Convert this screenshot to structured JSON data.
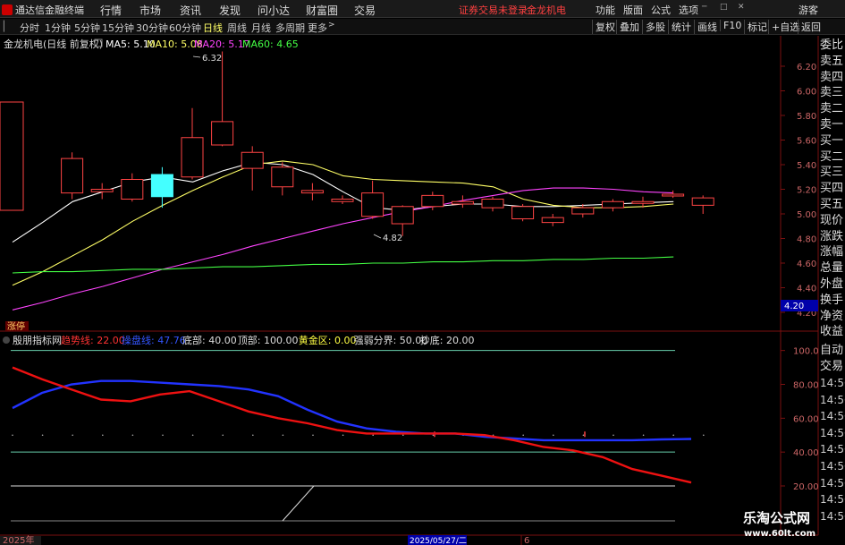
{
  "app": {
    "title": "通达信金融终端"
  },
  "menu": {
    "items": [
      "行情",
      "市场",
      "资讯",
      "发现",
      "问小达",
      "财富圈",
      "交易"
    ],
    "notice": "证券交易未登录",
    "stock": "金龙机电",
    "right": [
      "功能",
      "版面",
      "公式",
      "选项"
    ],
    "guest": "游客"
  },
  "toolbar": {
    "periods": [
      "分时",
      "1分钟",
      "5分钟",
      "15分钟",
      "30分钟",
      "60分钟",
      "日线",
      "周线",
      "月线",
      "多周期",
      "更多"
    ],
    "selected": "日线",
    "right": [
      "复权",
      "叠加",
      "多股",
      "统计",
      "画线",
      "F10",
      "标记",
      "+自选",
      "返回"
    ]
  },
  "main": {
    "label": "金龙机电(日线 前复权)",
    "ma": [
      {
        "label": "MA5: 5.10",
        "color": "#ffffff"
      },
      {
        "label": "MA10: 5.08",
        "color": "#ffff66"
      },
      {
        "label": "MA20: 5.17",
        "color": "#ff44ff"
      },
      {
        "label": "MA60: 4.65",
        "color": "#44ff44"
      }
    ],
    "y_ticks": [
      "6.20",
      "6.00",
      "5.80",
      "5.60",
      "5.40",
      "5.20",
      "5.00",
      "4.80",
      "4.60",
      "4.40",
      "4.20"
    ],
    "price_tag": "4.20",
    "high_label": "6.32",
    "low_label": "4.82",
    "zhangting": "涨停"
  },
  "candles": [
    {
      "o": 5.36,
      "c": 5.36,
      "h": 5.36,
      "l": 5.36
    },
    {
      "o": 5.17,
      "c": 5.45,
      "h": 5.5,
      "l": 5.12
    },
    {
      "o": 5.18,
      "c": 5.2,
      "h": 5.25,
      "l": 5.12
    },
    {
      "o": 5.12,
      "c": 5.28,
      "h": 5.33,
      "l": 5.1
    },
    {
      "o": 5.32,
      "c": 5.14,
      "h": 5.38,
      "l": 5.05
    },
    {
      "o": 5.3,
      "c": 5.62,
      "h": 5.86,
      "l": 5.28
    },
    {
      "o": 5.56,
      "c": 5.75,
      "h": 6.32,
      "l": 5.55
    },
    {
      "o": 5.37,
      "c": 5.5,
      "h": 5.55,
      "l": 5.19
    },
    {
      "o": 5.22,
      "c": 5.38,
      "h": 5.42,
      "l": 5.15
    },
    {
      "o": 5.17,
      "c": 5.19,
      "h": 5.25,
      "l": 5.11
    },
    {
      "o": 5.1,
      "c": 5.12,
      "h": 5.15,
      "l": 5.08
    },
    {
      "o": 4.98,
      "c": 5.17,
      "h": 5.27,
      "l": 4.96
    },
    {
      "o": 4.92,
      "c": 5.06,
      "h": 5.07,
      "l": 4.82
    },
    {
      "o": 5.06,
      "c": 5.15,
      "h": 5.18,
      "l": 5.03
    },
    {
      "o": 5.08,
      "c": 5.1,
      "h": 5.15,
      "l": 5.05
    },
    {
      "o": 5.05,
      "c": 5.12,
      "h": 5.14,
      "l": 5.02
    },
    {
      "o": 4.96,
      "c": 5.06,
      "h": 5.08,
      "l": 4.94
    },
    {
      "o": 4.93,
      "c": 4.97,
      "h": 5.0,
      "l": 4.9
    },
    {
      "o": 5.0,
      "c": 5.05,
      "h": 5.08,
      "l": 4.97
    },
    {
      "o": 5.05,
      "c": 5.1,
      "h": 5.12,
      "l": 5.02
    },
    {
      "o": 5.09,
      "c": 5.1,
      "h": 5.14,
      "l": 5.05
    },
    {
      "o": 5.15,
      "c": 5.16,
      "h": 5.19,
      "l": 5.13
    },
    {
      "o": 5.07,
      "c": 5.13,
      "h": 5.15,
      "l": 5.0
    }
  ],
  "ma_series": {
    "ma5": [
      4.77,
      4.93,
      5.1,
      5.18,
      5.26,
      5.3,
      5.26,
      5.35,
      5.42,
      5.4,
      5.32,
      5.18,
      5.05,
      5.03,
      5.06,
      5.08,
      5.08,
      5.06,
      5.06,
      5.07,
      5.08,
      5.09,
      5.1
    ],
    "ma10": [
      4.42,
      4.53,
      4.66,
      4.79,
      4.94,
      5.07,
      5.19,
      5.3,
      5.4,
      5.43,
      5.4,
      5.31,
      5.28,
      5.27,
      5.26,
      5.25,
      5.22,
      5.12,
      5.07,
      5.05,
      5.05,
      5.06,
      5.08
    ],
    "ma20": [
      4.22,
      4.28,
      4.35,
      4.41,
      4.48,
      4.55,
      4.61,
      4.67,
      4.74,
      4.8,
      4.86,
      4.92,
      4.97,
      5.02,
      5.06,
      5.11,
      5.15,
      5.19,
      5.21,
      5.21,
      5.2,
      5.18,
      5.17
    ],
    "ma60": [
      4.52,
      4.53,
      4.53,
      4.54,
      4.55,
      4.55,
      4.56,
      4.57,
      4.57,
      4.58,
      4.59,
      4.59,
      4.6,
      4.6,
      4.61,
      4.61,
      4.62,
      4.62,
      4.63,
      4.63,
      4.64,
      4.64,
      4.65
    ]
  },
  "indicator": {
    "name": "殷朋指标网",
    "values": [
      {
        "label": "趋势线: 22.00",
        "color": "#ff3333"
      },
      {
        "label": "操盘线: 47.76",
        "color": "#3355ff"
      },
      {
        "label": "底部: 40.00",
        "color": "#dddddd"
      },
      {
        "label": "顶部: 100.00",
        "color": "#dddddd"
      },
      {
        "label": "黄金区: 0.00",
        "color": "#ffff44"
      },
      {
        "label": "强弱分界: 50.00",
        "color": "#dddddd"
      },
      {
        "label": "抄底: 20.00",
        "color": "#dddddd"
      }
    ],
    "y_ticks": [
      "100.0",
      "80.00",
      "60.00",
      "40.00",
      "20.00"
    ],
    "trend": [
      90,
      83,
      77,
      71,
      70,
      74,
      76,
      70,
      64,
      60,
      57,
      53,
      51,
      51,
      51,
      51,
      50,
      47,
      43,
      41,
      37,
      30,
      26,
      22
    ],
    "operate": [
      66,
      75,
      80,
      82,
      82,
      81,
      80,
      79,
      77,
      73,
      65,
      58,
      54,
      52,
      51,
      51,
      49,
      48,
      47,
      47,
      47,
      47,
      47.5,
      47.76
    ]
  },
  "xaxis": {
    "left": "2025年",
    "cursor": "2025/05/27/二",
    "right": "6"
  },
  "right_panel": {
    "top": [
      "委比",
      "卖五",
      "卖四",
      "卖三",
      "卖二",
      "卖一",
      "买一",
      "买二",
      "买三",
      "买四",
      "买五",
      "现价",
      "涨跌",
      "涨幅",
      "总量",
      "外盘",
      "换手",
      "净资",
      "收益"
    ],
    "bottom": [
      "自动",
      "交易",
      "14:56",
      "14:56",
      "14:56",
      "14:56",
      "14:56",
      "14:56",
      "14:56",
      "14:56",
      "14:56"
    ]
  },
  "watermark": {
    "title": "乐淘公式网",
    "url": "www.60lt.com"
  },
  "colors": {
    "up": "#ff4444",
    "down": "#44ffff",
    "grid": "#7a1010"
  }
}
